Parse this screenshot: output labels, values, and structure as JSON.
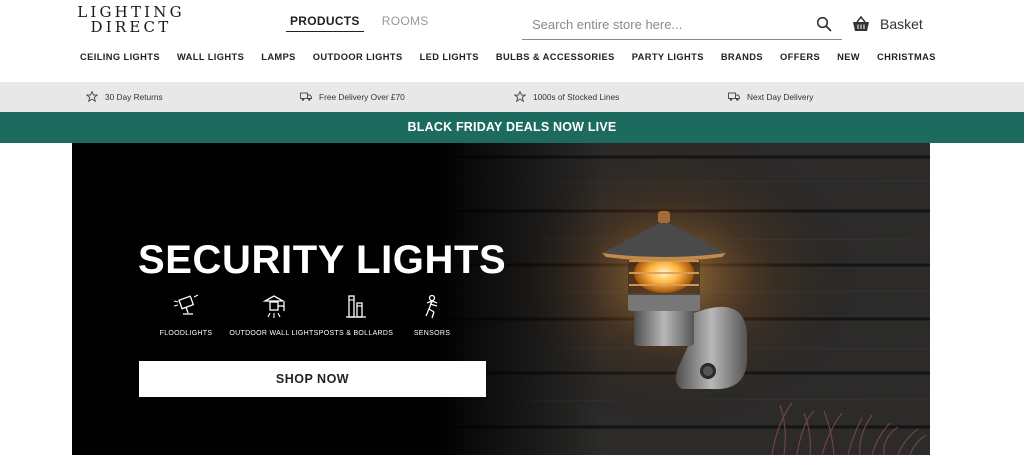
{
  "header": {
    "logo_line1": "LIGHTING",
    "logo_line2": "DIRECT",
    "tabs": [
      {
        "label": "PRODUCTS",
        "active": true
      },
      {
        "label": "ROOMS",
        "active": false
      }
    ],
    "search_placeholder": "Search entire store here...",
    "basket_label": "Basket"
  },
  "nav": {
    "items": [
      "CEILING LIGHTS",
      "WALL LIGHTS",
      "LAMPS",
      "OUTDOOR LIGHTS",
      "LED LIGHTS",
      "BULBS & ACCESSORIES",
      "PARTY LIGHTS",
      "BRANDS",
      "OFFERS",
      "NEW",
      "CHRISTMAS"
    ]
  },
  "usps": [
    {
      "icon": "star-icon",
      "text": "30 Day Returns"
    },
    {
      "icon": "truck-icon",
      "text": "Free Delivery Over £70"
    },
    {
      "icon": "star-icon",
      "text": "1000s of Stocked Lines"
    },
    {
      "icon": "truck-icon",
      "text": "Next Day Delivery"
    }
  ],
  "promo": {
    "text": "BLACK FRIDAY DEALS NOW LIVE"
  },
  "hero": {
    "title": "SECURITY LIGHTS",
    "categories": [
      {
        "label": "FLOODLIGHTS",
        "icon": "floodlight-icon"
      },
      {
        "label": "OUTDOOR WALL LIGHTS",
        "icon": "wall-lantern-icon"
      },
      {
        "label": "POSTS & BOLLARDS",
        "icon": "bollard-icon"
      },
      {
        "label": "SENSORS",
        "icon": "sensor-icon"
      }
    ],
    "cta": "SHOP NOW"
  },
  "colors": {
    "promo_bg": "#1c6b5e",
    "usp_bg": "#e8e8e8",
    "hero_bg": "#000000"
  }
}
